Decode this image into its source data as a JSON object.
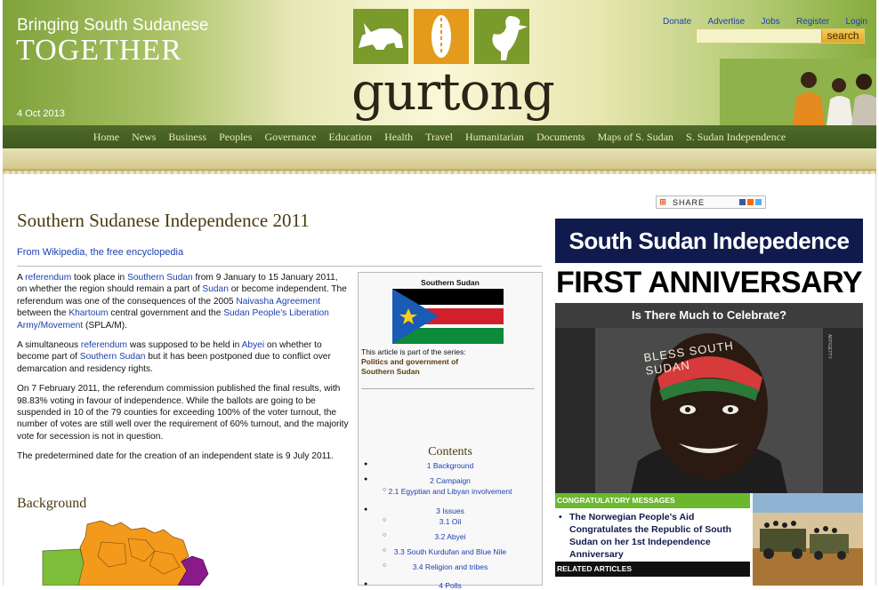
{
  "header": {
    "tagline_small": "Bringing South Sudanese",
    "tagline_big": "TOGETHER",
    "date": "4 Oct 2013",
    "logo_text": "gurtong",
    "top_links": [
      "Donate",
      "Advertise",
      "Jobs",
      "Register",
      "Login"
    ],
    "search": {
      "button_label": "search",
      "value": ""
    }
  },
  "nav": {
    "items": [
      "Home",
      "News",
      "Business",
      "Peoples",
      "Governance",
      "Education",
      "Health",
      "Travel",
      "Humanitarian",
      "Documents",
      "Maps of S. Sudan",
      "S. Sudan Independence"
    ]
  },
  "article": {
    "title": "Southern Sudanese Independence  2011",
    "source": "From Wikipedia, the free encyclopedia",
    "p1": {
      "t1": "A ",
      "l1": "referendum",
      "t2": " took place in ",
      "l2": "Southern Sudan",
      "t3": " from 9 January to 15 January 2011, on whether the region should remain a part of ",
      "l3": "Sudan",
      "t4": " or become independent. The referendum was one of the consequences of the 2005 ",
      "l4": "Naivasha Agreement",
      "t5": " between the ",
      "l5": "Khartoum",
      "t6": " central government and the ",
      "l6": "Sudan People's Liberation Army/Movement",
      "t7": " (SPLA/M)."
    },
    "p2": {
      "t1": "A simultaneous ",
      "l1": "referendum",
      "t2": " was supposed to be held in ",
      "l2": "Abyei",
      "t3": " on whether to become part of ",
      "l3": "Southern Sudan",
      "t4": " but it has been postponed due to conflict over demarcation and residency rights."
    },
    "p3": "On 7 February 2011, the referendum commission published the final results, with 98.83% voting in favour of independence. While the ballots are going to be suspended in 10 of the 79 counties for exceeding 100% of the voter turnout, the number of votes are still well over the requirement of 60% turnout, and the majority vote for secession is not in question.",
    "p4": "The predetermined date for the creation of an independent state is 9 July 2011.",
    "background_heading": "Background"
  },
  "infobox": {
    "title": "Southern Sudan",
    "series_intro": "This article is part of the series:",
    "series_name_1": "Politics and government of",
    "series_name_2": "Southern Sudan",
    "contents_title": "Contents",
    "toc": [
      {
        "label": "1 Background",
        "level": 1
      },
      {
        "label": "2 Campaign",
        "level": 1
      },
      {
        "label": "2.1 Egyptian and Libyan involvement",
        "level": 2
      },
      {
        "label": "3 Issues",
        "level": 1
      },
      {
        "label": "3.1 Oil",
        "level": 2
      },
      {
        "label": "3.2 Abyei",
        "level": 2
      },
      {
        "label": "3.3 South Kurdufan and Blue Nile",
        "level": 2
      },
      {
        "label": "3.4 Religion and tribes",
        "level": 2
      },
      {
        "label": "4 Polls",
        "level": 1
      }
    ]
  },
  "share": {
    "label": "SHARE"
  },
  "ad": {
    "banner": "South Sudan Indepedence",
    "anniversary": "FIRST ANNIVERSARY",
    "question": "Is There Much to Celebrate?",
    "photo_caption": "BLESS SOUTH SUDAN",
    "photo_credit": "AFP/GETTY",
    "congrats_heading": "CONGRATULATORY MESSAGES",
    "congrats_item": "The Norwegian People's Aid Congratulates the Republic of South Sudan on her 1st Independence Anniversary",
    "related_heading": "RELATED ARTICLES"
  }
}
